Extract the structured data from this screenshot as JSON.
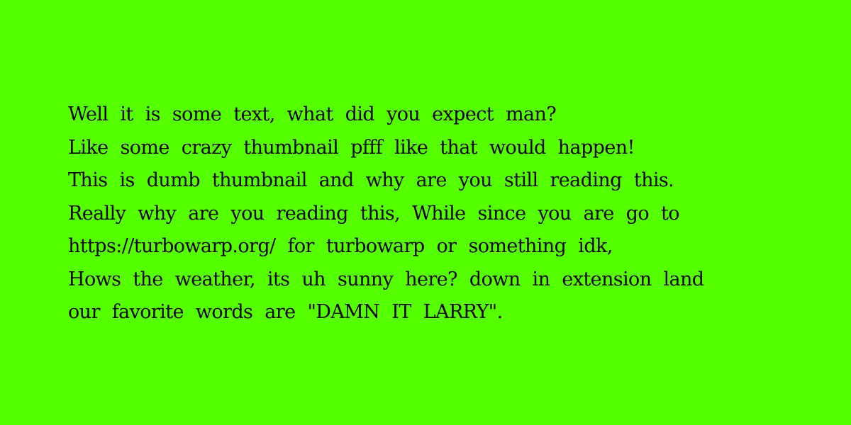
{
  "background_color": "#55ff00",
  "text_color": "#000000",
  "lines": [
    "Well it is some text, what did you expect man?",
    "Like some crazy thumbnail pfff like that would happen!",
    "This is dumb thumbnail and why are you still reading this.",
    "Really why are you reading this, While since you are go to",
    "https://turbowarp.org/ for turbowarp or something idk,",
    "Hows the weather, its uh sunny here? down in extension land",
    "our favorite words are \"DAMN IT LARRY\"."
  ]
}
